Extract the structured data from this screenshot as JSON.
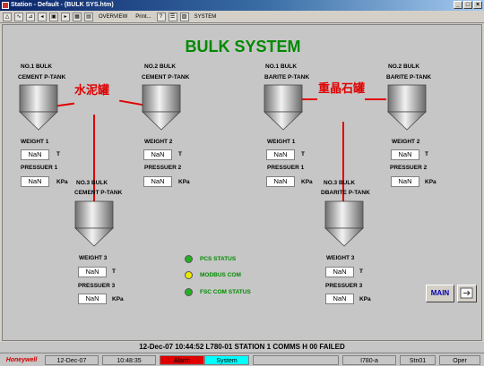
{
  "window": {
    "title": "Station - Default - (BULK SYS.htm)"
  },
  "toolbar": {
    "overview": "OVERVIEW",
    "print": "Print...",
    "system": "SYSTEM"
  },
  "heading": "BULK SYSTEM",
  "tanks": {
    "t1": {
      "name1": "NO.1 BULK",
      "name2": "CEMENT P-TANK",
      "weight_label": "WEIGHT 1",
      "weight": "NaN",
      "weight_unit": "T",
      "pressure_label": "PRESSUER 1",
      "pressure": "NaN",
      "pressure_unit": "KPa"
    },
    "t2": {
      "name1": "NO.2 BULK",
      "name2": "CEMENT P-TANK",
      "weight_label": "WEIGHT 2",
      "weight": "NaN",
      "weight_unit": "T",
      "pressure_label": "PRESSUER 2",
      "pressure": "NaN",
      "pressure_unit": "KPa"
    },
    "t3": {
      "name1": "NO.3 BULK",
      "name2": "CEMENT P-TANK",
      "weight_label": "WEIGHT 3",
      "weight": "NaN",
      "weight_unit": "T",
      "pressure_label": "PRESSUER 3",
      "pressure": "NaN",
      "pressure_unit": "KPa"
    },
    "t4": {
      "name1": "NO.1 BULK",
      "name2": "BARITE P-TANK",
      "weight_label": "WEIGHT 1",
      "weight": "NaN",
      "weight_unit": "T",
      "pressure_label": "PRESSUER 1",
      "pressure": "NaN",
      "pressure_unit": "KPa"
    },
    "t5": {
      "name1": "NO.2 BULK",
      "name2": "BARITE P-TANK",
      "weight_label": "WEIGHT 2",
      "weight": "NaN",
      "weight_unit": "T",
      "pressure_label": "PRESSUER 2",
      "pressure": "NaN",
      "pressure_unit": "KPa"
    },
    "t6": {
      "name1": "NO.3 BULK",
      "name2": "DBARITE P-TANK",
      "weight_label": "WEIGHT 3",
      "weight": "NaN",
      "weight_unit": "T",
      "pressure_label": "PRESSUER 3",
      "pressure": "NaN",
      "pressure_unit": "KPa"
    }
  },
  "annotations": {
    "cement": "水泥罐",
    "barite": "重晶石罐"
  },
  "status": {
    "pcs": {
      "label": "PCS STATUS",
      "color": "#22b022"
    },
    "modbus": {
      "label": "MODBUS COM",
      "color": "#e8e800"
    },
    "fsc": {
      "label": "FSC COM STATUS",
      "color": "#22b022"
    }
  },
  "buttons": {
    "main": "MAIN",
    "nav_icon": "display-nav-icon"
  },
  "alarm_line": "12-Dec-07   10:44:52  L780-01  STATION 1   COMMS   H 00   FAILED",
  "statusbar": {
    "brand": "Honeywell",
    "date": "12-Dec-07",
    "time": "10:48:35",
    "alarm": "Alarm",
    "system": "System",
    "node": "I780-a",
    "station": "Stn01",
    "level": "Oper",
    "alarm_color": "#e00000",
    "system_color": "#00ffff"
  }
}
